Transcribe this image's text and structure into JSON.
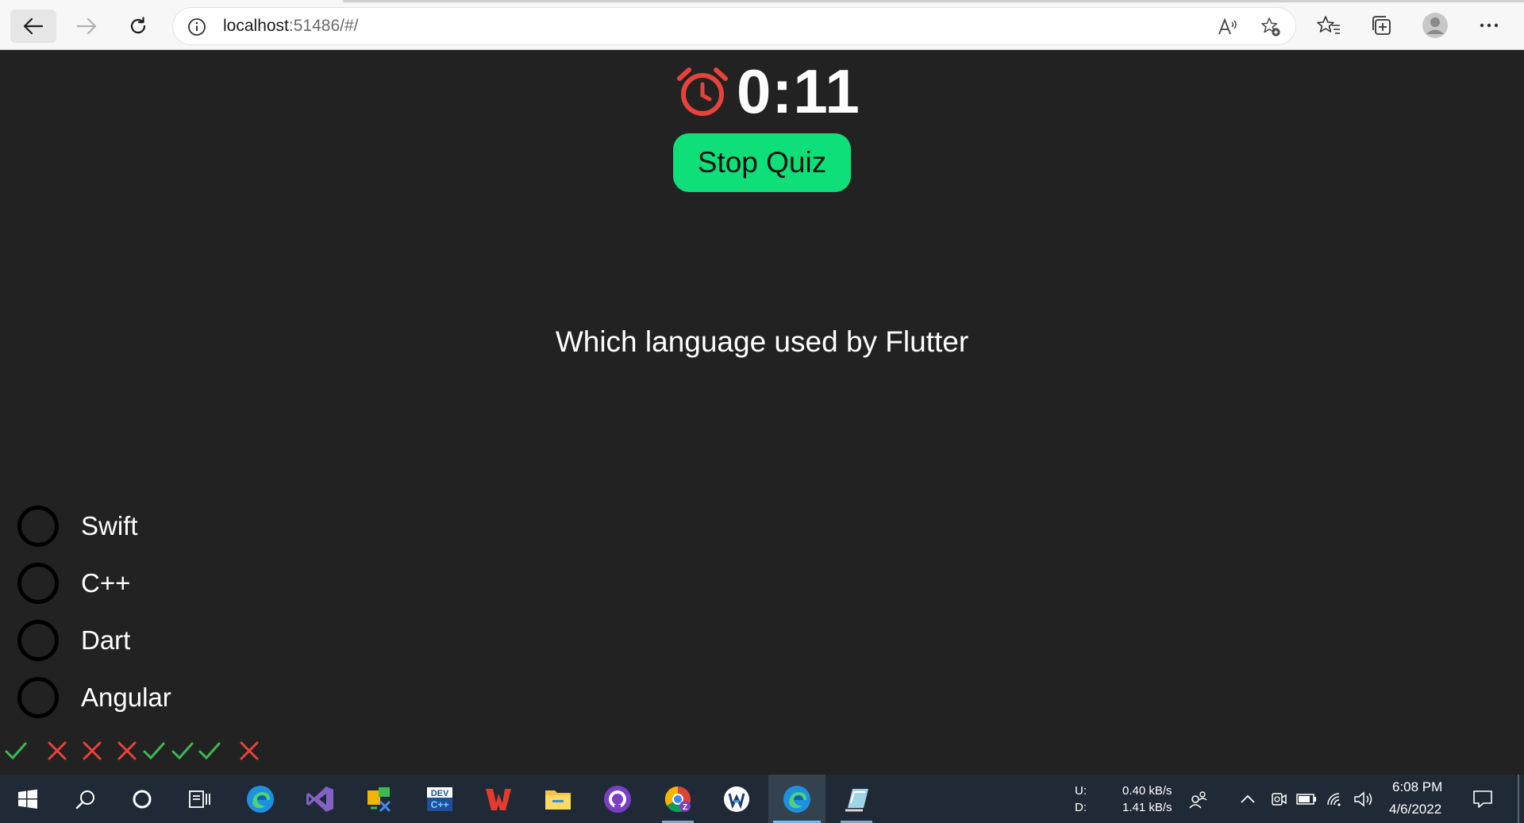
{
  "browser": {
    "url_host": "localhost",
    "url_rest": ":51486/#/",
    "icons": [
      "back-arrow-icon",
      "forward-arrow-icon",
      "reload-icon",
      "info-icon",
      "read-aloud-icon",
      "add-favorite-icon",
      "favorites-icon",
      "collections-icon",
      "profile-icon",
      "more-icon"
    ]
  },
  "quiz": {
    "timer": "0:11",
    "timer_icon": "alarm-clock-icon",
    "timer_icon_color": "#e8433a",
    "stop_button_label": "Stop Quiz",
    "stop_button_color": "#0fdf78",
    "question": "Which language used by Flutter",
    "options": [
      {
        "label": "Swift"
      },
      {
        "label": "C++"
      },
      {
        "label": "Dart"
      },
      {
        "label": "Angular"
      }
    ],
    "score_marks": [
      "correct",
      "wrong",
      "wrong",
      "wrong",
      "correct",
      "correct",
      "correct",
      "wrong"
    ],
    "correct_color": "#3cba54",
    "wrong_color": "#e8433a"
  },
  "taskbar": {
    "apps": [
      "windows-start-icon",
      "search-icon",
      "cortana-icon",
      "task-view-icon",
      "edge-icon",
      "visual-studio-icon",
      "app-icon",
      "devcpp-icon",
      "wps-office-icon",
      "file-explorer-icon",
      "github-icon",
      "chrome-icon",
      "app-icon",
      "edge-icon",
      "app-icon"
    ],
    "net_upload_label": "U:",
    "net_download_label": "D:",
    "net_upload": "0.40 kB/s",
    "net_download": "1.41 kB/s",
    "time": "6:08 PM",
    "date": "4/6/2022"
  }
}
